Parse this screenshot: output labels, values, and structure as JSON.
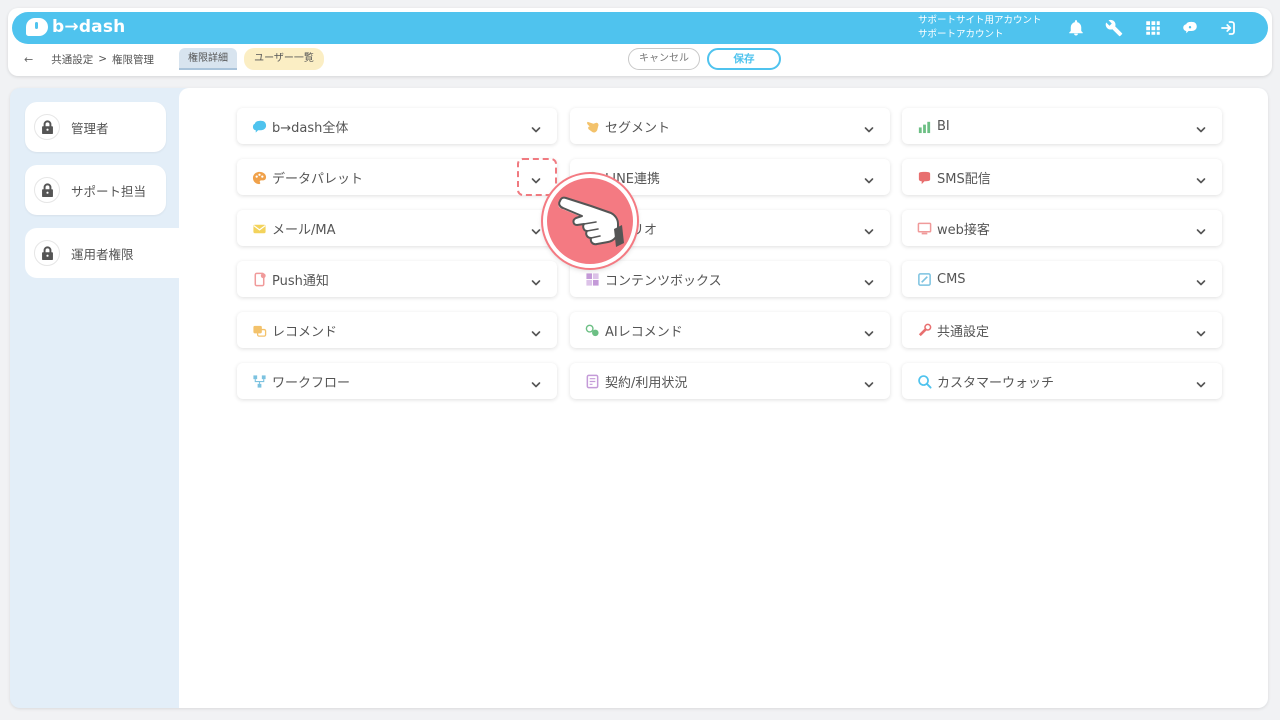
{
  "header": {
    "logo_text": "b→dash",
    "account_line1": "サポートサイト用アカウント",
    "account_line2": "サポートアカウント",
    "icons": [
      "bell-icon",
      "wrench-icon",
      "grid-icon",
      "brain-icon",
      "logout-icon"
    ]
  },
  "subbar": {
    "back_icon": "←",
    "crumb_1": "共通設定",
    "crumb_sep": ">",
    "crumb_2": "権限管理",
    "tab_detail": "権限詳細",
    "tab_users": "ユーザー一覧",
    "cancel_label": "キャンセル",
    "save_label": "保存"
  },
  "sidebar": {
    "items": [
      {
        "label": "管理者"
      },
      {
        "label": "サポート担当"
      },
      {
        "label": "運用者権限"
      }
    ]
  },
  "cards": [
    {
      "label": "b→dash全体",
      "icon": "brain-icon",
      "color": "#4fc3ee"
    },
    {
      "label": "セグメント",
      "icon": "hand-icon",
      "color": "#f3c26b"
    },
    {
      "label": "BI",
      "icon": "chart-icon",
      "color": "#6cbf84"
    },
    {
      "label": "データパレット",
      "icon": "palette-icon",
      "color": "#f0a14a"
    },
    {
      "label": "LINE連携",
      "icon": "line-icon",
      "color": "#8fd37a"
    },
    {
      "label": "SMS配信",
      "icon": "sms-icon",
      "color": "#e86f6f"
    },
    {
      "label": "メール/MA",
      "icon": "mail-icon",
      "color": "#f3d35c"
    },
    {
      "label": "シナリオ",
      "icon": "scenario-icon",
      "color": "#9ab6e3"
    },
    {
      "label": "web接客",
      "icon": "web-icon",
      "color": "#f09a9a"
    },
    {
      "label": "Push通知",
      "icon": "push-icon",
      "color": "#f09a9a"
    },
    {
      "label": "コンテンツボックス",
      "icon": "box-icon",
      "color": "#c49ad8"
    },
    {
      "label": "CMS",
      "icon": "cms-icon",
      "color": "#7cc2e0"
    },
    {
      "label": "レコメンド",
      "icon": "recommend-icon",
      "color": "#f3c26b"
    },
    {
      "label": "AIレコメンド",
      "icon": "ai-recommend-icon",
      "color": "#6cbf84"
    },
    {
      "label": "共通設定",
      "icon": "settings-icon",
      "color": "#e86f6f"
    },
    {
      "label": "ワークフロー",
      "icon": "workflow-icon",
      "color": "#7cc2e0"
    },
    {
      "label": "契約/利用状況",
      "icon": "contract-icon",
      "color": "#c49ad8"
    },
    {
      "label": "カスタマーウォッチ",
      "icon": "search-icon",
      "color": "#4fc3ee"
    }
  ],
  "pointer_icon": "hand-pointer-icon",
  "accent_color": "#4fc3ee",
  "highlight_color": "#f47a82"
}
